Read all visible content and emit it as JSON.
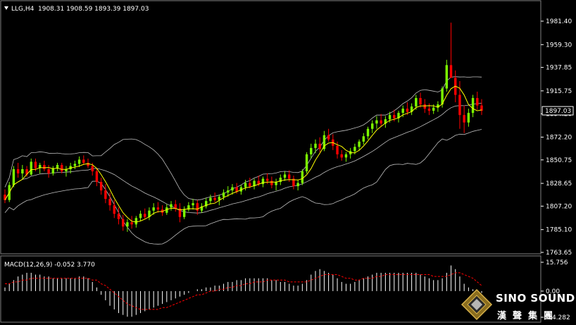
{
  "header": {
    "symbol": "LLG,H4",
    "ohlc": "1908.31 1908.59 1893.39 1897.03",
    "dropdown_icon": "triangle-down-icon"
  },
  "price_axis": {
    "labels": [
      "1981.40",
      "1959.30",
      "1937.85",
      "1915.75",
      "1894.20",
      "1872.20",
      "1850.75",
      "1828.65",
      "1807.20",
      "1785.10",
      "1763.65"
    ],
    "current_price": "1897.03"
  },
  "macd": {
    "label": "MACD(12,26,9) -0.052 3.770",
    "axis_labels": [
      "15.756",
      "0.00",
      "-14.282"
    ]
  },
  "logo": {
    "main": "SINO SOUND",
    "sub": "漢聲集團",
    "icon": "diamond-logo-icon"
  },
  "colors": {
    "background": "#000000",
    "bull": "#7CFC00",
    "bear": "#FF0000",
    "ma": "#FFFF00",
    "band": "#C0C0C0",
    "macd_hist": "#FFFFFF",
    "macd_signal": "#FF0000",
    "grid": "#404040"
  },
  "chart_data": {
    "type": "candlestick",
    "title": "LLG,H4",
    "ylim": [
      1763.65,
      1985
    ],
    "indicators": [
      "Bollinger Bands",
      "Moving Average",
      "MACD(12,26,9)"
    ],
    "ohlc": [
      [
        1818,
        1823,
        1810,
        1813
      ],
      [
        1813,
        1830,
        1811,
        1827
      ],
      [
        1827,
        1845,
        1825,
        1842
      ],
      [
        1842,
        1848,
        1834,
        1838
      ],
      [
        1838,
        1846,
        1833,
        1842
      ],
      [
        1842,
        1845,
        1835,
        1837
      ],
      [
        1837,
        1852,
        1836,
        1849
      ],
      [
        1849,
        1852,
        1840,
        1843
      ],
      [
        1843,
        1848,
        1838,
        1846
      ],
      [
        1846,
        1850,
        1840,
        1842
      ],
      [
        1842,
        1846,
        1834,
        1838
      ],
      [
        1838,
        1845,
        1836,
        1843
      ],
      [
        1843,
        1848,
        1840,
        1846
      ],
      [
        1846,
        1848,
        1838,
        1840
      ],
      [
        1840,
        1845,
        1835,
        1842
      ],
      [
        1842,
        1848,
        1838,
        1845
      ],
      [
        1845,
        1850,
        1842,
        1847
      ],
      [
        1847,
        1854,
        1844,
        1851
      ],
      [
        1851,
        1855,
        1846,
        1848
      ],
      [
        1848,
        1852,
        1843,
        1845
      ],
      [
        1845,
        1848,
        1836,
        1840
      ],
      [
        1840,
        1843,
        1826,
        1830
      ],
      [
        1830,
        1834,
        1818,
        1822
      ],
      [
        1822,
        1828,
        1810,
        1814
      ],
      [
        1814,
        1820,
        1803,
        1808
      ],
      [
        1808,
        1813,
        1796,
        1800
      ],
      [
        1800,
        1806,
        1790,
        1795
      ],
      [
        1795,
        1799,
        1784,
        1788
      ],
      [
        1788,
        1795,
        1783,
        1792
      ],
      [
        1792,
        1798,
        1786,
        1790
      ],
      [
        1790,
        1798,
        1787,
        1796
      ],
      [
        1796,
        1803,
        1793,
        1800
      ],
      [
        1800,
        1805,
        1795,
        1797
      ],
      [
        1797,
        1806,
        1794,
        1803
      ],
      [
        1803,
        1810,
        1799,
        1806
      ],
      [
        1806,
        1811,
        1801,
        1804
      ],
      [
        1804,
        1808,
        1798,
        1801
      ],
      [
        1801,
        1809,
        1799,
        1806
      ],
      [
        1806,
        1812,
        1803,
        1809
      ],
      [
        1809,
        1813,
        1802,
        1805
      ],
      [
        1805,
        1810,
        1792,
        1797
      ],
      [
        1797,
        1807,
        1795,
        1804
      ],
      [
        1804,
        1811,
        1802,
        1808
      ],
      [
        1808,
        1814,
        1804,
        1810
      ],
      [
        1810,
        1813,
        1799,
        1803
      ],
      [
        1803,
        1810,
        1801,
        1807
      ],
      [
        1807,
        1815,
        1805,
        1812
      ],
      [
        1812,
        1818,
        1809,
        1815
      ],
      [
        1815,
        1820,
        1811,
        1813
      ],
      [
        1813,
        1818,
        1808,
        1816
      ],
      [
        1816,
        1823,
        1813,
        1820
      ],
      [
        1820,
        1826,
        1816,
        1822
      ],
      [
        1822,
        1828,
        1818,
        1825
      ],
      [
        1825,
        1829,
        1819,
        1821
      ],
      [
        1821,
        1827,
        1818,
        1825
      ],
      [
        1825,
        1832,
        1822,
        1829
      ],
      [
        1829,
        1834,
        1824,
        1826
      ],
      [
        1826,
        1833,
        1823,
        1831
      ],
      [
        1831,
        1836,
        1826,
        1828
      ],
      [
        1828,
        1835,
        1825,
        1833
      ],
      [
        1833,
        1838,
        1828,
        1831
      ],
      [
        1831,
        1835,
        1824,
        1827
      ],
      [
        1827,
        1833,
        1822,
        1830
      ],
      [
        1830,
        1837,
        1827,
        1834
      ],
      [
        1834,
        1840,
        1831,
        1837
      ],
      [
        1837,
        1841,
        1830,
        1833
      ],
      [
        1833,
        1836,
        1823,
        1826
      ],
      [
        1826,
        1832,
        1822,
        1829
      ],
      [
        1829,
        1842,
        1827,
        1840
      ],
      [
        1840,
        1858,
        1838,
        1856
      ],
      [
        1856,
        1866,
        1852,
        1862
      ],
      [
        1862,
        1870,
        1857,
        1866
      ],
      [
        1866,
        1872,
        1858,
        1861
      ],
      [
        1861,
        1878,
        1859,
        1874
      ],
      [
        1874,
        1880,
        1868,
        1870
      ],
      [
        1870,
        1875,
        1860,
        1864
      ],
      [
        1864,
        1868,
        1852,
        1856
      ],
      [
        1856,
        1860,
        1850,
        1853
      ],
      [
        1853,
        1858,
        1849,
        1856
      ],
      [
        1856,
        1862,
        1852,
        1859
      ],
      [
        1859,
        1866,
        1856,
        1863
      ],
      [
        1863,
        1870,
        1860,
        1868
      ],
      [
        1868,
        1876,
        1865,
        1873
      ],
      [
        1873,
        1882,
        1870,
        1880
      ],
      [
        1880,
        1888,
        1876,
        1885
      ],
      [
        1885,
        1892,
        1880,
        1888
      ],
      [
        1888,
        1894,
        1882,
        1885
      ],
      [
        1885,
        1892,
        1881,
        1889
      ],
      [
        1889,
        1896,
        1886,
        1893
      ],
      [
        1893,
        1898,
        1887,
        1890
      ],
      [
        1890,
        1897,
        1886,
        1895
      ],
      [
        1895,
        1902,
        1891,
        1899
      ],
      [
        1899,
        1905,
        1893,
        1896
      ],
      [
        1896,
        1904,
        1893,
        1901
      ],
      [
        1901,
        1912,
        1898,
        1909
      ],
      [
        1909,
        1914,
        1900,
        1903
      ],
      [
        1903,
        1908,
        1895,
        1899
      ],
      [
        1899,
        1904,
        1893,
        1897
      ],
      [
        1897,
        1903,
        1894,
        1900
      ],
      [
        1900,
        1906,
        1896,
        1903
      ],
      [
        1903,
        1920,
        1900,
        1918
      ],
      [
        1918,
        1945,
        1915,
        1940
      ],
      [
        1940,
        1980,
        1935,
        1928
      ],
      [
        1928,
        1935,
        1905,
        1912
      ],
      [
        1912,
        1925,
        1880,
        1893
      ],
      [
        1893,
        1902,
        1876,
        1886
      ],
      [
        1886,
        1899,
        1882,
        1895
      ],
      [
        1895,
        1912,
        1891,
        1909
      ],
      [
        1909,
        1915,
        1898,
        1902
      ],
      [
        1902,
        1908,
        1893,
        1897
      ]
    ],
    "macd_hist": [
      2,
      4,
      6,
      8,
      9,
      10,
      10,
      9,
      9,
      8,
      8,
      7,
      7,
      7,
      7,
      7,
      7,
      8,
      8,
      7,
      5,
      2,
      -2,
      -5,
      -8,
      -10,
      -12,
      -13,
      -14,
      -14,
      -13,
      -12,
      -11,
      -10,
      -9,
      -8,
      -7,
      -6,
      -5,
      -4,
      -3,
      -2,
      -1,
      0,
      1,
      1,
      2,
      2,
      3,
      3,
      4,
      5,
      5,
      6,
      6,
      7,
      7,
      7,
      7,
      7,
      7,
      6,
      6,
      5,
      5,
      4,
      3,
      3,
      4,
      6,
      9,
      11,
      12,
      11,
      10,
      9,
      7,
      5,
      4,
      4,
      5,
      6,
      7,
      8,
      9,
      10,
      10,
      10,
      10,
      10,
      10,
      10,
      10,
      10,
      10,
      9,
      8,
      7,
      6,
      6,
      7,
      10,
      14,
      12,
      8,
      4,
      2,
      1,
      0,
      -1
    ],
    "macd_signal": [
      4,
      4,
      5,
      5,
      6,
      6,
      7,
      7,
      7,
      7,
      7,
      7,
      7,
      7,
      7,
      7,
      7,
      7,
      7,
      7,
      6,
      6,
      4,
      3,
      1,
      -1,
      -3,
      -5,
      -7,
      -8,
      -9,
      -10,
      -10,
      -10,
      -10,
      -10,
      -9,
      -9,
      -8,
      -7,
      -6,
      -5,
      -4,
      -3,
      -2,
      -2,
      -1,
      0,
      0,
      1,
      1,
      2,
      2,
      3,
      3,
      4,
      4,
      5,
      5,
      5,
      6,
      6,
      6,
      6,
      6,
      5,
      5,
      5,
      5,
      5,
      6,
      7,
      8,
      9,
      9,
      9,
      9,
      8,
      7,
      7,
      6,
      6,
      7,
      7,
      7,
      8,
      8,
      9,
      9,
      9,
      9,
      9,
      9,
      9,
      9,
      9,
      9,
      9,
      8,
      8,
      8,
      8,
      9,
      10,
      10,
      9,
      8,
      7,
      5,
      3
    ],
    "macd_ylim": [
      -14.282,
      15.756
    ]
  }
}
